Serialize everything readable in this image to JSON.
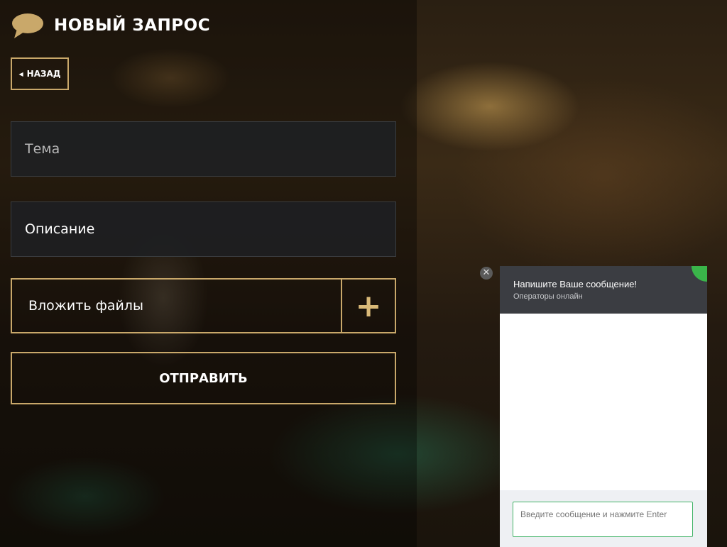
{
  "header": {
    "title": "НОВЫЙ ЗАПРОС",
    "icon": "speech-bubble-icon",
    "icon_color": "#c9a86a"
  },
  "back_button": {
    "label": "НАЗАД",
    "icon": "caret-left-icon"
  },
  "form": {
    "subject_placeholder": "Тема",
    "description_placeholder": "Описание",
    "attach_label": "Вложить файлы",
    "attach_icon_glyph": "+",
    "submit_label": "ОТПРАВИТЬ"
  },
  "chat_widget": {
    "title": "Напишите Ваше сообщение!",
    "subtitle": "Операторы онлайн",
    "input_placeholder": "Введите сообщение и нажмите Enter",
    "close_glyph": "✕",
    "status_color": "#3ab54a"
  },
  "colors": {
    "accent": "#c9a86a",
    "field_bg": "#1e2022",
    "chat_header": "#3b3d42"
  }
}
